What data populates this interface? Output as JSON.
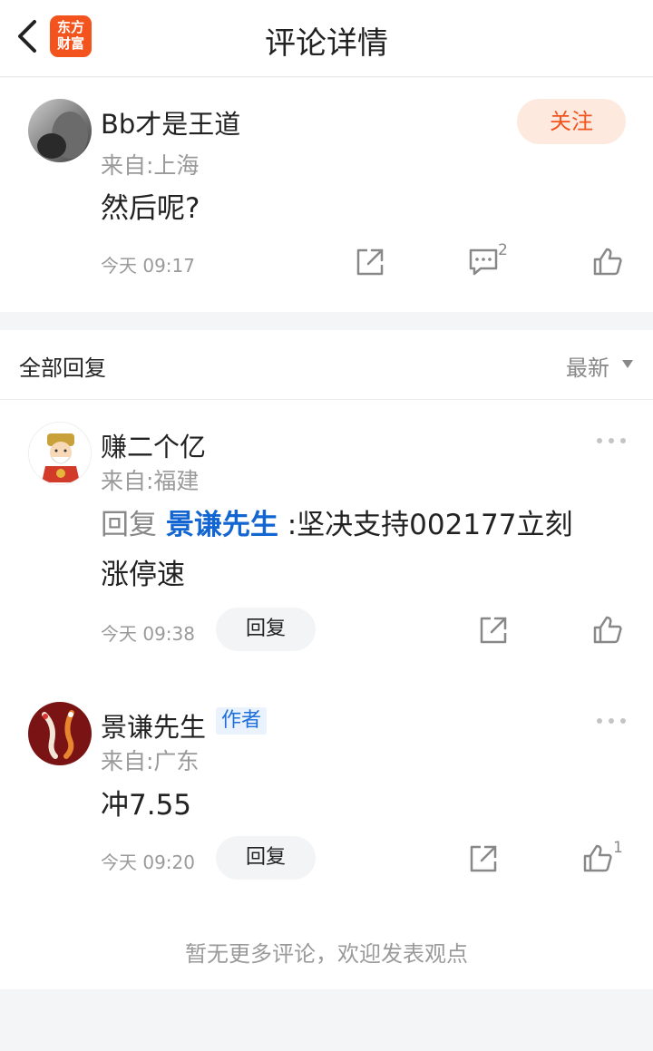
{
  "header": {
    "title": "评论详情",
    "logo_line1": "东方",
    "logo_line2": "财富"
  },
  "main_comment": {
    "username": "Bb才是王道",
    "location": "来自:上海",
    "content": "然后呢?",
    "time": "今天 09:17",
    "follow_label": "关注",
    "comment_count": "2"
  },
  "replies_header": {
    "title": "全部回复",
    "sort_label": "最新"
  },
  "replies": [
    {
      "username": "赚二个亿",
      "location": "来自:福建",
      "reply_prefix": "回复",
      "reply_to": "景谦先生",
      "reply_text": ":坚决支持002177立刻",
      "reply_text_line2": "涨停速",
      "time": "今天 09:38",
      "reply_button": "回复"
    },
    {
      "username": "景谦先生",
      "author_tag": "作者",
      "location": "来自:广东",
      "content": "冲7.55",
      "time": "今天 09:20",
      "reply_button": "回复",
      "like_count": "1"
    }
  ],
  "footer": {
    "note": "暂无更多评论，欢迎发表观点"
  },
  "colors": {
    "brand": "#f3541e",
    "link_blue": "#1366d1",
    "follow_bg": "#fde9de",
    "muted": "#9a9a9a"
  }
}
